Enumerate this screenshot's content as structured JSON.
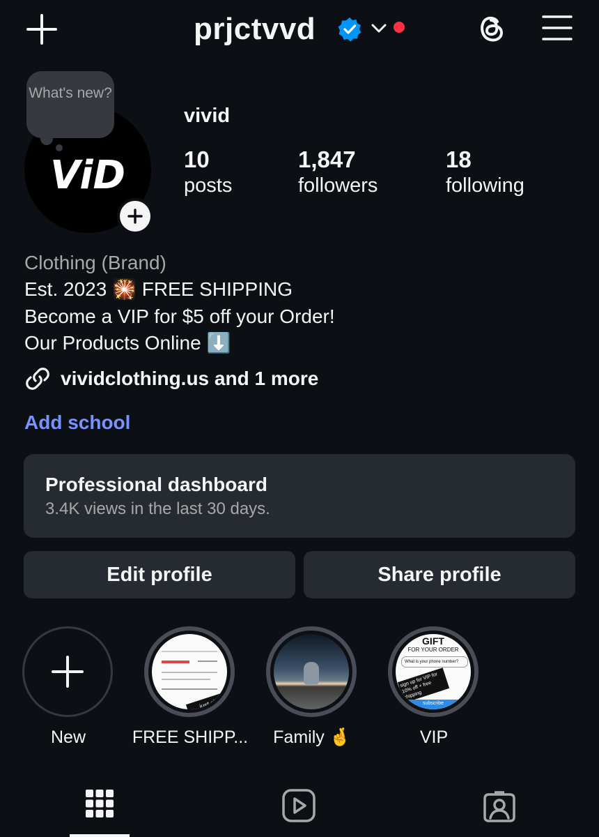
{
  "header": {
    "username": "prjctvvd",
    "add_icon": "plus-icon",
    "verified_icon": "verified-badge-icon",
    "dropdown_icon": "chevron-down-icon",
    "notification_dot_color": "#ff3040",
    "threads_icon": "threads-icon",
    "menu_icon": "hamburger-menu-icon"
  },
  "profile": {
    "note_bubble": "What's new?",
    "avatar_logo": "ViD",
    "display_name": "vivid",
    "stats": [
      {
        "count": "10",
        "label": "posts"
      },
      {
        "count": "1,847",
        "label": "followers"
      },
      {
        "count": "18",
        "label": "following"
      }
    ],
    "category": "Clothing (Brand)",
    "bio": [
      "Est. 2023 🎇 FREE SHIPPING",
      "Become a VIP for $5 off your Order!",
      "Our Products Online ⬇️"
    ],
    "link_text": "vividclothing.us and 1 more",
    "add_school": "Add school"
  },
  "dashboard": {
    "title": "Professional dashboard",
    "subtitle": "3.4K views in the last 30 days."
  },
  "buttons": {
    "edit": "Edit profile",
    "share": "Share profile"
  },
  "highlights": [
    {
      "label": "New"
    },
    {
      "label": "FREE SHIPP..."
    },
    {
      "label": "Family 🤞"
    },
    {
      "label": "VIP"
    }
  ],
  "highlight_texts": {
    "vip_title": "GIFT",
    "vip_sub": "FOR YOUR ORDER",
    "vip_input": "What is your phone number?",
    "vip_sticker": "sign up for VIP for 10% off + free shipping",
    "vip_button": "subscribe",
    "ship_sticker": "just click"
  },
  "colors": {
    "background": "#0c1014",
    "accent_link": "#7893ff",
    "secondary_text": "#a8a8a8",
    "card": "#262a31",
    "verified": "#0095f6"
  },
  "tabs": [
    {
      "name": "grid-icon",
      "active": true
    },
    {
      "name": "reels-icon",
      "active": false
    },
    {
      "name": "tagged-icon",
      "active": false
    }
  ]
}
